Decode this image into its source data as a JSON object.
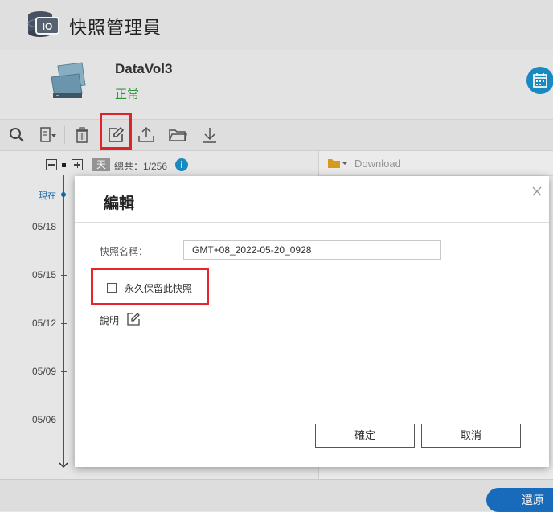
{
  "app": {
    "title": "快照管理員"
  },
  "volume": {
    "name": "DataVol3",
    "status": "正常"
  },
  "timeline": {
    "day_tag": "天",
    "total": "總共：1/256",
    "info": "i",
    "now_label": "現在",
    "dates": [
      "05/18",
      "05/15",
      "05/12",
      "05/09",
      "05/06"
    ]
  },
  "folder": {
    "name": "Download"
  },
  "bottom": {
    "restore_label": "還原"
  },
  "dialog": {
    "title": "編輯",
    "name_label": "快照名稱：",
    "name_value": "GMT+08_2022-05-20_0928",
    "keep_label": "永久保留此快照",
    "keep_checked": false,
    "desc_label": "說明",
    "ok_label": "確定",
    "cancel_label": "取消"
  },
  "colors": {
    "accent": "#1a8fc9",
    "status_ok": "#2e9e3a",
    "highlight": "#e5262c"
  },
  "icons": [
    "database-icon",
    "volume-icon",
    "calendar-icon",
    "search-icon",
    "view-list-icon",
    "trash-icon",
    "edit-icon",
    "upload-icon",
    "folder-open-icon",
    "download-icon",
    "close-icon",
    "pencil-icon",
    "folder-icon"
  ]
}
